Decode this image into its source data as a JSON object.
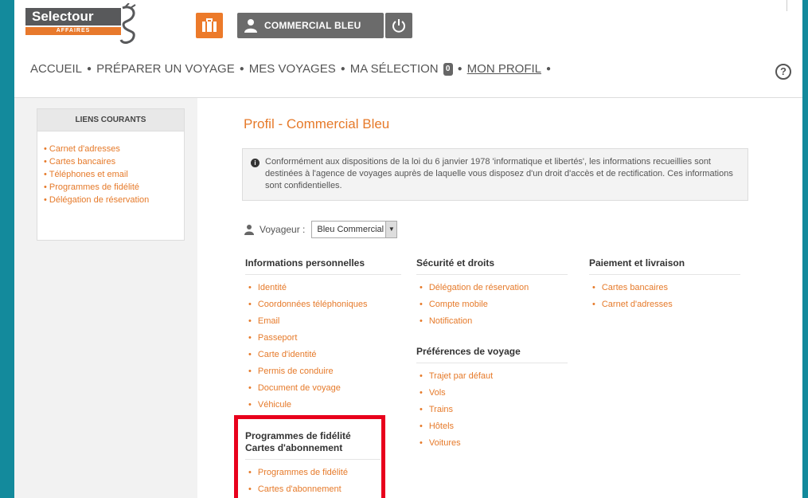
{
  "brand": {
    "name": "Selectour",
    "tagline": "AFFAIRES"
  },
  "header": {
    "user_label": "COMMERCIAL BLEU"
  },
  "nav": {
    "items": [
      "ACCUEIL",
      "PRÉPARER UN VOYAGE",
      "MES VOYAGES",
      "MA SÉLECTION"
    ],
    "badge": "0",
    "active": "MON PROFIL"
  },
  "sidebar": {
    "title": "LIENS COURANTS",
    "items": [
      "Carnet d'adresses",
      "Cartes bancaires",
      "Téléphones et email",
      "Programmes de fidélité",
      "Délégation de réservation"
    ]
  },
  "main": {
    "title": "Profil - Commercial Bleu",
    "notice": "Conformément aux dispositions de la loi du 6 janvier 1978 'informatique et libertés', les informations recueillies sont destinées à l'agence de voyages auprès de laquelle vous disposez d'un droit d'accès et de rectification. Ces informations sont confidentielles.",
    "traveler_label": "Voyageur :",
    "traveler_value": "Bleu Commercial"
  },
  "sections": {
    "personal": {
      "title": "Informations personnelles",
      "items": [
        "Identité",
        "Coordonnées téléphoniques",
        "Email",
        "Passeport",
        "Carte d'identité",
        "Permis de conduire",
        "Document de voyage",
        "Véhicule"
      ]
    },
    "security": {
      "title": "Sécurité et droits",
      "items": [
        "Délégation de réservation",
        "Compte mobile",
        "Notification"
      ]
    },
    "preferences": {
      "title": "Préférences de voyage",
      "items": [
        "Trajet par défaut",
        "Vols",
        "Trains",
        "Hôtels",
        "Voitures"
      ]
    },
    "payment": {
      "title": "Paiement et livraison",
      "items": [
        "Cartes bancaires",
        "Carnet d'adresses"
      ]
    },
    "loyalty": {
      "title_line1": "Programmes de fidélité",
      "title_line2": "Cartes d'abonnement",
      "items": [
        "Programmes de fidélité",
        "Cartes d'abonnement"
      ]
    }
  },
  "colors": {
    "accent": "#e67a2a",
    "highlight": "#e8001c",
    "frame": "#138a9c"
  },
  "icons": [
    "suitcase-icon",
    "user-icon",
    "power-icon",
    "help-icon",
    "info-icon",
    "person-icon"
  ]
}
